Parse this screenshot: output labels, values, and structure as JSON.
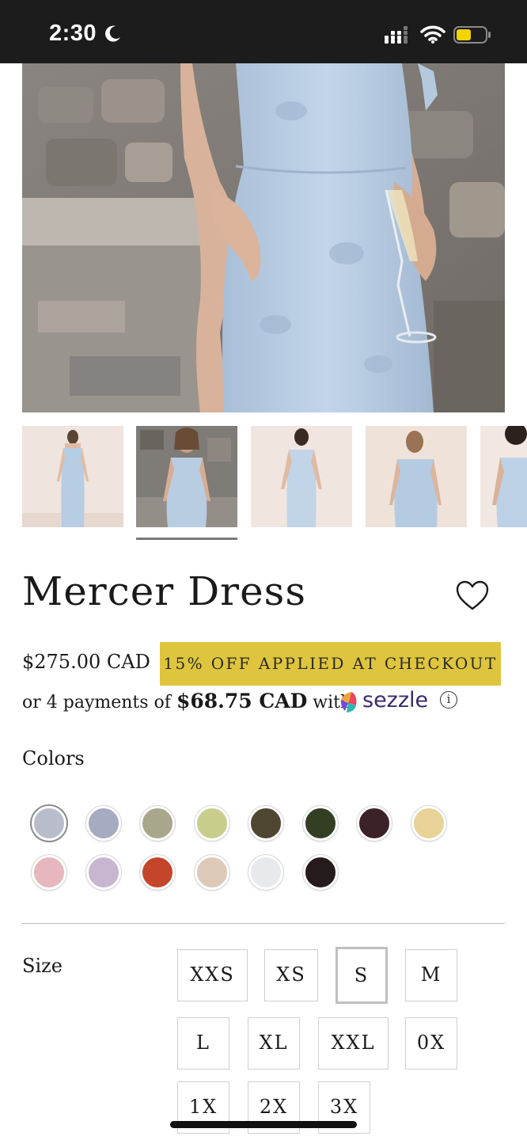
{
  "status_bar": {
    "time": "2:30",
    "icons": [
      "moon-icon",
      "cellular-signal-icon",
      "wifi-icon",
      "battery-icon"
    ]
  },
  "gallery": {
    "thumbnail_count": 5,
    "selected_thumbnail": 2
  },
  "product": {
    "title": "Mercer Dress",
    "price": "$275.00 CAD",
    "promo_badge": "15% OFF APPLIED AT CHECKOUT",
    "installments_prefix": "or 4 payments of",
    "installments_amount": "$68.75 CAD",
    "installments_with": "with",
    "installments_provider": "sezzle",
    "info_glyph": "i"
  },
  "colors": {
    "label": "Colors",
    "swatches": [
      "#b9bccb",
      "#a7abc2",
      "#a8a78b",
      "#c9cd8c",
      "#4f4631",
      "#343e23",
      "#3b2228",
      "#e8d297",
      "#e6b7bf",
      "#c8b5d0",
      "#c4452a",
      "#ddc9b7",
      "#e7e9ec",
      "#241b1a"
    ],
    "selected_index": 0
  },
  "sizes": {
    "label": "Size",
    "options": [
      "XXS",
      "XS",
      "S",
      "M",
      "L",
      "XL",
      "XXL",
      "0X",
      "1X",
      "2X",
      "3X"
    ],
    "selected": "S"
  },
  "theme": {
    "promo_color": "#dec53d",
    "sezzle_color": "#3a2b6e",
    "dress_color": "#b7cce2"
  }
}
